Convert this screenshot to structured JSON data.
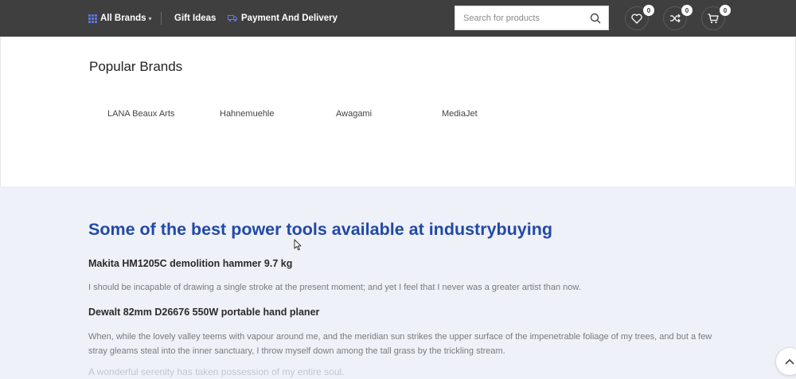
{
  "header": {
    "all_brands": "All Brands",
    "gift_ideas": "Gift Ideas",
    "payment_delivery": "Payment And Delivery",
    "search_placeholder": "Search for products",
    "wishlist_count": "0",
    "compare_count": "0",
    "cart_count": "0",
    "icons": [
      "grid-icon",
      "caret-down-icon",
      "truck-icon",
      "search-icon",
      "heart-icon",
      "shuffle-icon",
      "cart-icon"
    ]
  },
  "brands": {
    "title": "Popular Brands",
    "items": [
      "LANA Beaux Arts",
      "Hahnemuehle",
      "Awagami",
      "MediaJet"
    ]
  },
  "info": {
    "title": "Some of the best power tools available at industrybuying",
    "products": [
      {
        "heading": "Makita HM1205C demolition hammer 9.7 kg",
        "text": "I should be incapable of drawing a single stroke at the present moment; and yet I feel that I never was a greater artist than now."
      },
      {
        "heading": "Dewalt 82mm D26676 550W portable hand planer",
        "text": "When, while the lovely valley teems with vapour around me, and the meridian sun strikes the upper surface of the impenetrable foliage of my trees, and but a few stray gleams steal into the inner sanctuary, I throw myself down among the tall grass by the trickling stream."
      }
    ],
    "faded_line": "A wonderful serenity has taken possession of my entire soul."
  },
  "colors": {
    "header_bg": "#3f3f3f",
    "accent_blue": "#2149a8",
    "info_bg": "#eff1f8"
  }
}
